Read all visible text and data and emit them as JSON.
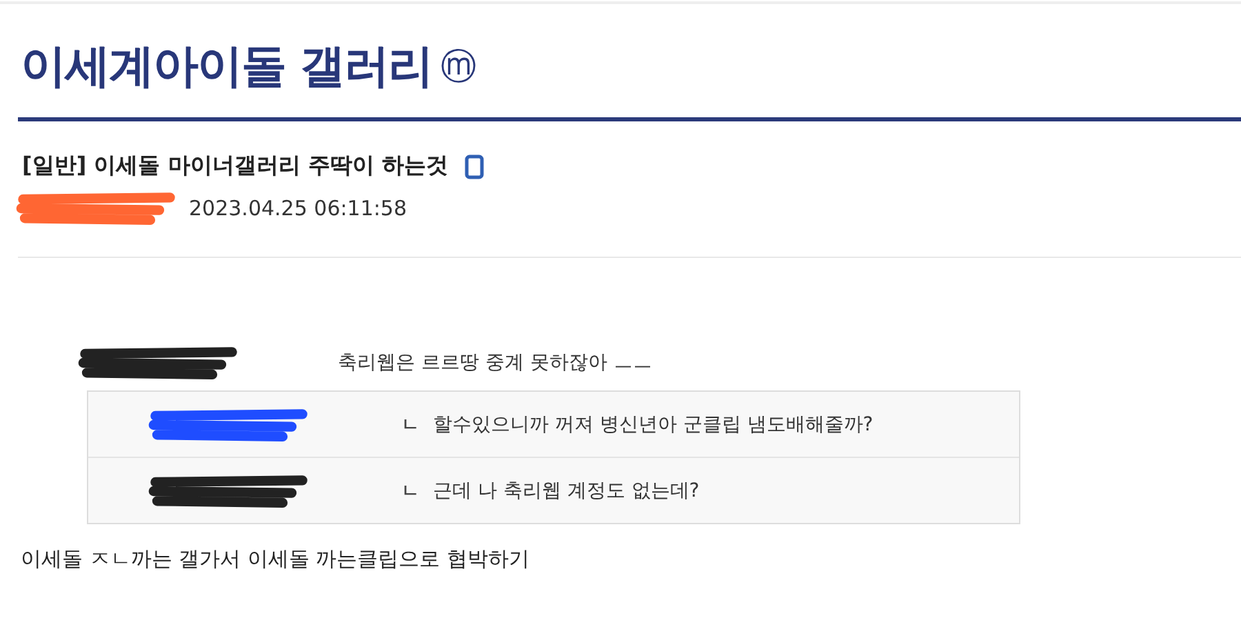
{
  "gallery": {
    "title": "이세계아이돌 갤러리",
    "badge": "ⓜ"
  },
  "post": {
    "title": "[일반] 이세돌 마이너갤러리 주딱이 하는것",
    "author": {
      "color": "#ff6633"
    },
    "date": "2023.04.25 06:11:58"
  },
  "comments": [
    {
      "text": "축리웹은 르르땅 중계 못하잖아 ㅡㅡ",
      "reply": false,
      "color": "#222222"
    },
    {
      "text": "할수있으니까 꺼져 병신년아 군클립 냄도배해줄까?",
      "reply": true,
      "marker": "ㄴ",
      "color": "#1f4dff"
    },
    {
      "text": "근데 나 축리웹 계정도 없는데?",
      "reply": true,
      "marker": "ㄴ",
      "color": "#222222"
    }
  ],
  "body": "이세돌 ㅈㄴ까는 갤가서 이세돌 까는클립으로 협박하기"
}
